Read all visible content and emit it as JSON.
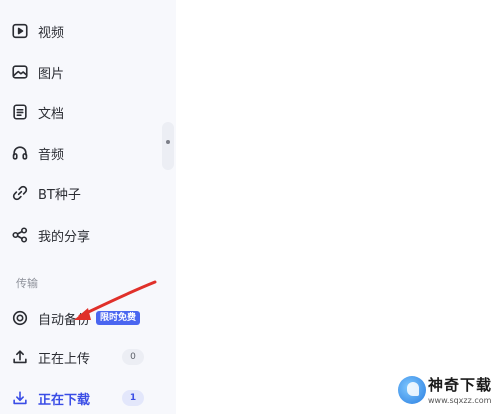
{
  "sidebar": {
    "items": [
      {
        "label": "视频",
        "icon": "video-icon"
      },
      {
        "label": "图片",
        "icon": "image-icon"
      },
      {
        "label": "文档",
        "icon": "document-icon"
      },
      {
        "label": "音频",
        "icon": "headphones-icon"
      },
      {
        "label": "BT种子",
        "icon": "link-icon"
      },
      {
        "label": "我的分享",
        "icon": "share-icon"
      }
    ],
    "transfer_section_label": "传输",
    "transfer_items": [
      {
        "label": "自动备份",
        "icon": "backup-icon",
        "badge": "限时免费"
      },
      {
        "label": "正在上传",
        "icon": "upload-icon",
        "count": "0"
      },
      {
        "label": "正在下载",
        "icon": "download-icon",
        "count": "1",
        "active": true
      }
    ]
  },
  "watermark": {
    "title": "神奇下载",
    "url": "www.sqxzz.com"
  },
  "colors": {
    "accent": "#3a4de6",
    "badge": "#4a66f0",
    "arrow": "#e0302a",
    "sidebar_bg": "#f7f8fc"
  }
}
